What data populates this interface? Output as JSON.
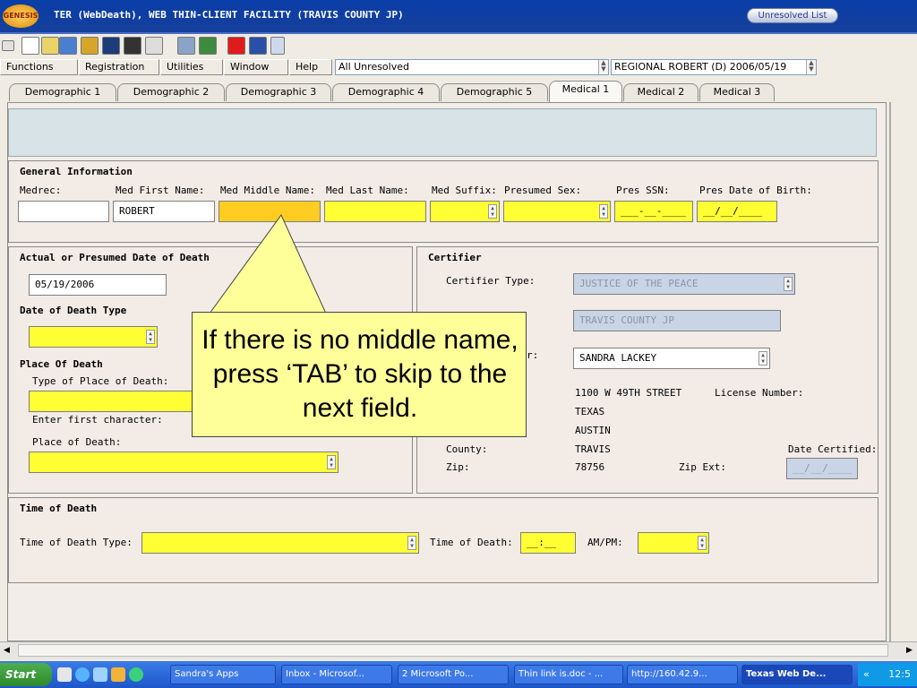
{
  "app": {
    "logo_text": "GENESIS",
    "window_title": "TER (WebDeath), WEB THIN-CLIENT FACILITY (TRAVIS COUNTY JP)",
    "unresolved_button": "Unresolved List"
  },
  "menu": {
    "items": [
      "Functions",
      "Registration",
      "Utilities",
      "Window",
      "Help"
    ],
    "filter_value": "All Unresolved",
    "record_value": "REGIONAL ROBERT (D) 2006/05/19"
  },
  "tabs": [
    {
      "label": "Demographic 1"
    },
    {
      "label": "Demographic 2"
    },
    {
      "label": "Demographic 3"
    },
    {
      "label": "Demographic 4"
    },
    {
      "label": "Demographic 5"
    },
    {
      "label": "Medical 1"
    },
    {
      "label": "Medical 2"
    },
    {
      "label": "Medical 3"
    }
  ],
  "general": {
    "header": "General Information",
    "labels": [
      "Medrec:",
      "Med First Name:",
      "Med Middle Name:",
      "Med Last Name:",
      "Med Suffix:",
      "Presumed Sex:",
      "Pres SSN:",
      "Pres Date of Birth:"
    ],
    "medrec": "",
    "first_name": "ROBERT",
    "middle_name": "",
    "last_name": "",
    "suffix": "",
    "sex": "",
    "ssn": "___-__-____",
    "dob": "__/__/____"
  },
  "death_date": {
    "header": "Actual or Presumed Date of Death",
    "date": "05/19/2006",
    "type_header": "Date of Death Type",
    "place_header": "Place Of Death",
    "place_type_label": "Type of Place of Death:",
    "first_char_label": "Enter first character:",
    "place_label": "Place of Death:"
  },
  "certifier": {
    "header": "Certifier",
    "type_label": "Certifier Type:",
    "type_value": "JUSTICE OF THE PEACE",
    "org_value": "TRAVIS COUNTY JP",
    "name_label_tail": "r:",
    "name_value": "SANDRA  LACKEY",
    "street": "1100 W 49TH STREET",
    "license_label": "License Number:",
    "state": "TEXAS",
    "city": "AUSTIN",
    "county_label": "County:",
    "county": "TRAVIS",
    "date_certified_label": "Date Certified:",
    "zip_label": "Zip:",
    "zip": "78756",
    "zip_ext_label": "Zip Ext:",
    "date_certified": "__/__/____"
  },
  "time_of_death": {
    "header": "Time of Death",
    "type_label": "Time of Death Type:",
    "time_label": "Time of Death:",
    "time_value": "__:__",
    "ampm_label": "AM/PM:"
  },
  "callout": {
    "text": "If there is no middle name, press ‘TAB’ to skip to the next field."
  },
  "taskbar": {
    "start": "Start",
    "tasks": [
      "Sandra's Apps",
      "Inbox - Microsof...",
      "2 Microsoft Po...",
      "Thin link is.doc - ...",
      "http://160.42.9...",
      "Texas Web De..."
    ],
    "clock": "12:5"
  },
  "colors": {
    "required": "#ffff33",
    "focused": "#ffcc22",
    "disabled": "#c9d4e6",
    "banner": "#d7e3e7"
  }
}
